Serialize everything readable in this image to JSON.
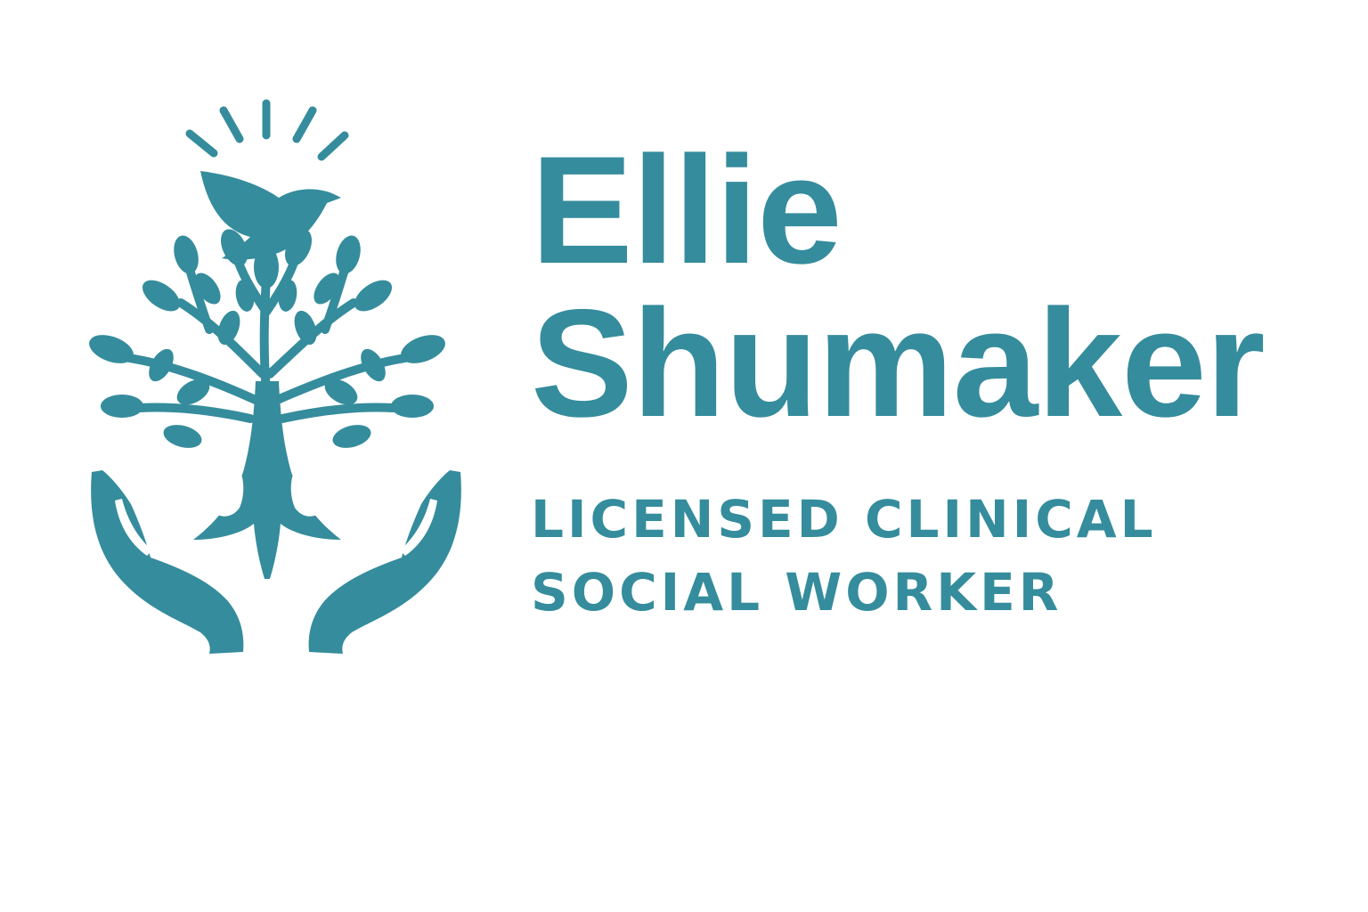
{
  "brand": {
    "first_name": "Ellie",
    "last_name": "Shumaker",
    "tagline_line1": "LICENSED CLINICAL",
    "tagline_line2": "SOCIAL WORKER"
  },
  "colors": {
    "primary": "#358c9c",
    "background": "#ffffff"
  },
  "icons": {
    "logo": "tree-in-hands-with-dove-icon"
  }
}
